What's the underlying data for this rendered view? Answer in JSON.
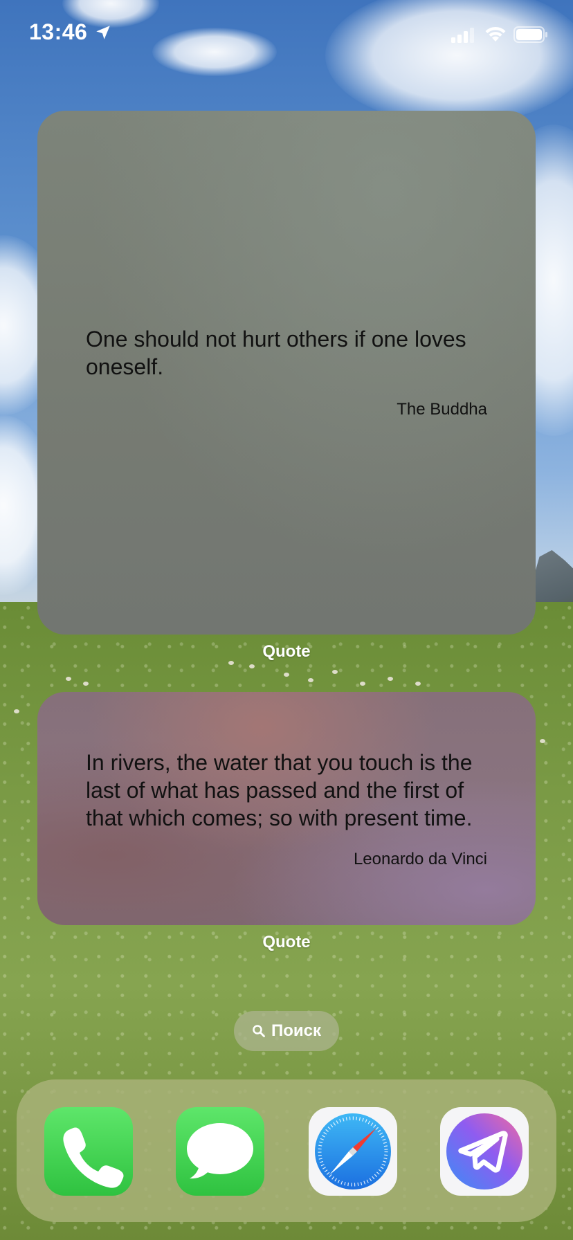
{
  "status_bar": {
    "time": "13:46",
    "location_icon": "location-arrow-icon",
    "signal_icon": "cellular-signal-icon",
    "wifi_icon": "wifi-icon",
    "battery_icon": "battery-icon"
  },
  "widgets": [
    {
      "quote": "One should not hurt others if one loves oneself.",
      "author": "The Buddha",
      "caption": "Quote"
    },
    {
      "quote": "In rivers, the water that you touch is the last of what has passed and the first of that which comes; so with present time.",
      "author": "Leonardo da Vinci",
      "caption": "Quote"
    }
  ],
  "search": {
    "label": "Поиск",
    "icon": "search-icon"
  },
  "dock": {
    "apps": [
      {
        "name": "Phone",
        "icon": "phone-icon",
        "color": "#34c759"
      },
      {
        "name": "Messages",
        "icon": "messages-icon",
        "color": "#34c759"
      },
      {
        "name": "Safari",
        "icon": "safari-compass-icon",
        "color": "#1e88f0"
      },
      {
        "name": "Telegram",
        "icon": "telegram-plane-icon",
        "color": "#8a5cf0"
      }
    ]
  }
}
